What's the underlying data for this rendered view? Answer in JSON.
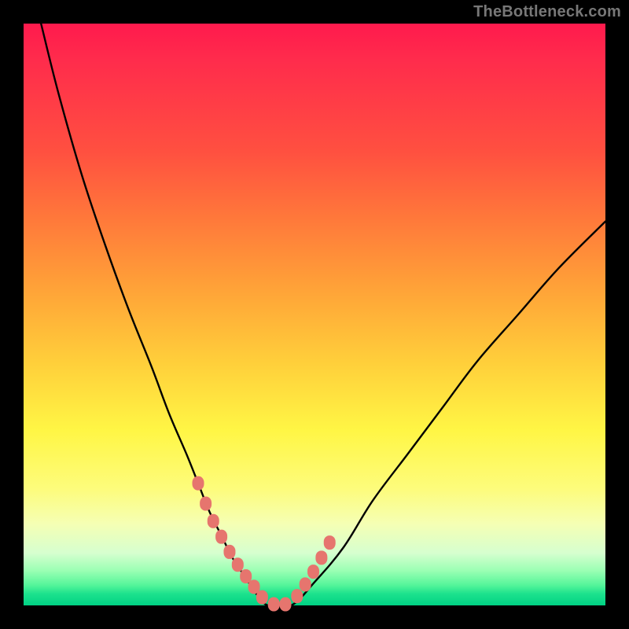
{
  "watermark": "TheBottleneck.com",
  "colors": {
    "page_bg": "#000000",
    "gradient_top": "#ff1a4d",
    "gradient_mid": "#fff645",
    "gradient_bottom": "#00d184",
    "curve": "#000000",
    "marker": "#e6756e"
  },
  "chart_data": {
    "type": "line",
    "title": "",
    "xlabel": "",
    "ylabel": "",
    "xlim": [
      0,
      100
    ],
    "ylim": [
      0,
      100
    ],
    "grid": false,
    "series": [
      {
        "name": "curve",
        "x": [
          3,
          6,
          10,
          14,
          18,
          22,
          25,
          28,
          30,
          32,
          34,
          36,
          38,
          40,
          42,
          46,
          50,
          55,
          60,
          66,
          72,
          78,
          85,
          92,
          100
        ],
        "y": [
          100,
          88,
          74,
          62,
          51,
          41,
          33,
          26,
          21,
          16,
          12,
          8,
          5,
          2,
          0,
          0,
          4,
          10,
          18,
          26,
          34,
          42,
          50,
          58,
          66
        ]
      }
    ],
    "markers": {
      "name": "highlight-segment",
      "x": [
        30.0,
        31.3,
        32.6,
        34.0,
        35.4,
        36.8,
        38.2,
        39.6,
        41.0,
        43.0,
        45.0,
        47.0,
        48.4,
        49.8,
        51.2,
        52.6
      ],
      "y": [
        21.0,
        17.5,
        14.5,
        11.8,
        9.2,
        7.0,
        5.0,
        3.2,
        1.4,
        0.2,
        0.2,
        1.6,
        3.6,
        5.8,
        8.2,
        10.8
      ]
    }
  }
}
